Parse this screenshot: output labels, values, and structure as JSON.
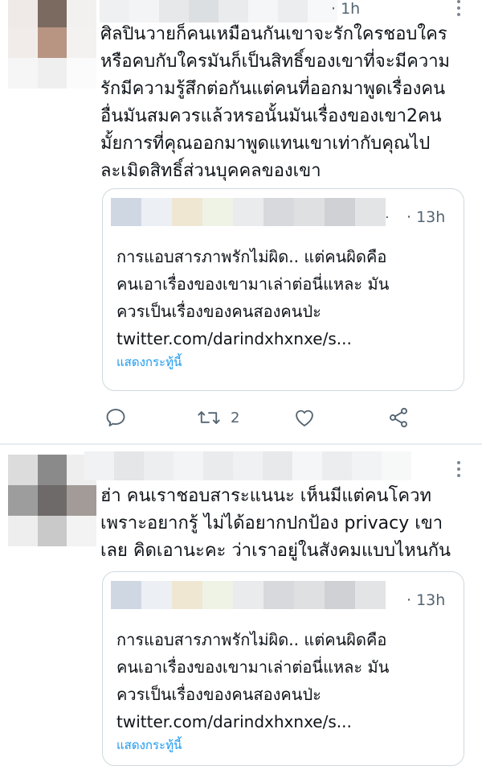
{
  "colors": {
    "text": "#0f1419",
    "secondary": "#536471",
    "link": "#1d9bf0",
    "border": "#cfd9de",
    "icon": "#536471"
  },
  "tweets": [
    {
      "time": "· 1h",
      "body_lines": [
        "ศิลปินวายก็คนเหมือนกันเขาจะรักใครชอบใคร",
        "หรือคบกับใครมันก็เป็นสิทธิ์ของเขาที่จะมีความ",
        "รักมีความรู้สึกต่อกันแต่คนที่ออกมาพูดเรื่องคน",
        "อื่นมันสมควรแล้วหรอนั้นมันเรื่องของเขา2คน",
        "มั้ยการที่คุณออกมาพูดแทนเขาเท่ากับคุณไป",
        "ละเมิดสิทธิ์ส่วนบุคคลของเขา"
      ],
      "quote": {
        "dot": ".",
        "time": "· 13h",
        "text_lines": [
          "การแอบสารภาพรักไม่ผิด.. แต่คนผิดคือ",
          "คนเอาเรื่องของเขามาเล่าต่อนี่แหละ มัน",
          "ควรเป็นเรื่องของคนสองคนป่ะ",
          "twitter.com/darindxhxnxe/s..."
        ],
        "show_thread": "แสดงกระทู้นี้"
      },
      "actions": {
        "reply_icon": "reply-icon",
        "retweet_icon": "retweet-icon",
        "retweet_count": "2",
        "like_icon": "heart-icon",
        "share_icon": "share-icon"
      }
    },
    {
      "body_lines": [
        "ฮ่า คนเราชอบสาระแนนะ เห็นมีแต่คนโควท",
        "เพราะอยากรู้ ไม่ได้อยากปกป้อง privacy เขา",
        "เลย คิดเอานะคะ ว่าเราอยู่ในสังคมแบบไหนกัน"
      ],
      "quote": {
        "time": "· 13h",
        "text_lines": [
          "การแอบสารภาพรักไม่ผิด.. แต่คนผิดคือ",
          "คนเอาเรื่องของเขามาเล่าต่อนี่แหละ มัน",
          "ควรเป็นเรื่องของคนสองคนป่ะ",
          "twitter.com/darindxhxnxe/s..."
        ],
        "show_thread": "แสดงกระทู้นี้"
      }
    }
  ]
}
